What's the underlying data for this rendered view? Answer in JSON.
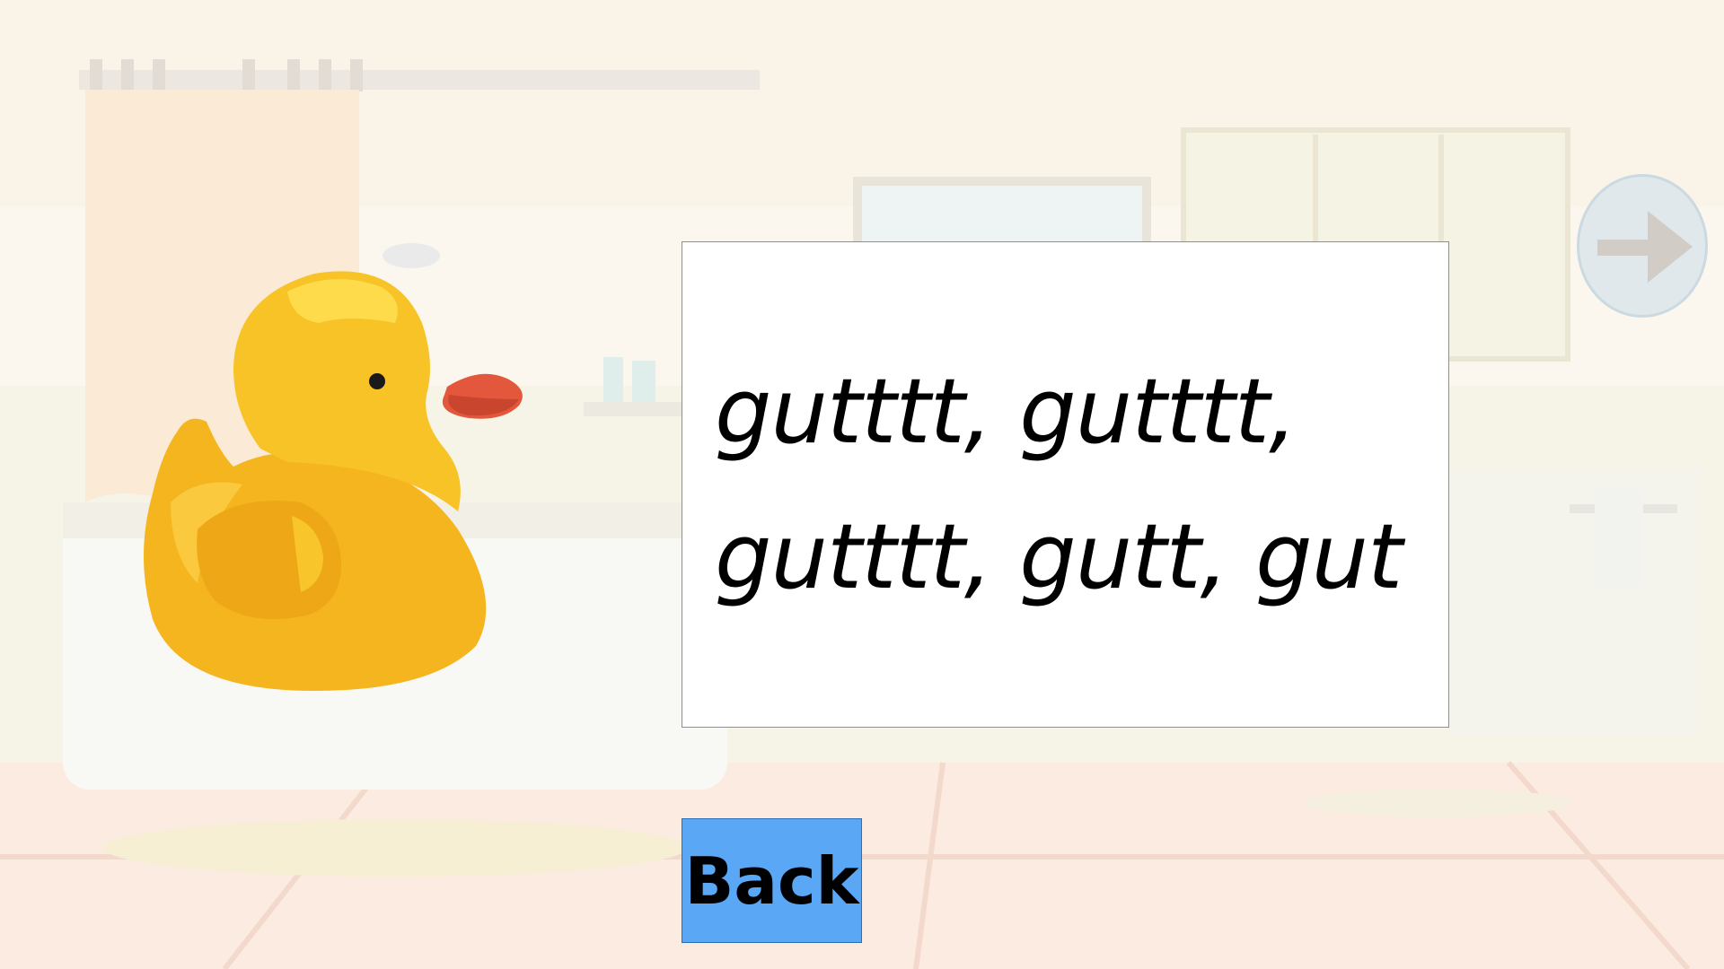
{
  "card": {
    "line1": "gutttt, gutttt,",
    "line2": "gutttt, gutt, gut"
  },
  "controls": {
    "back_label": "Back",
    "next_icon": "arrow-right-icon"
  },
  "colors": {
    "back_button": "#5aa7f5",
    "duck_body": "#f7c326",
    "duck_beak": "#e3583c",
    "next_button": "#e0e8ec"
  }
}
